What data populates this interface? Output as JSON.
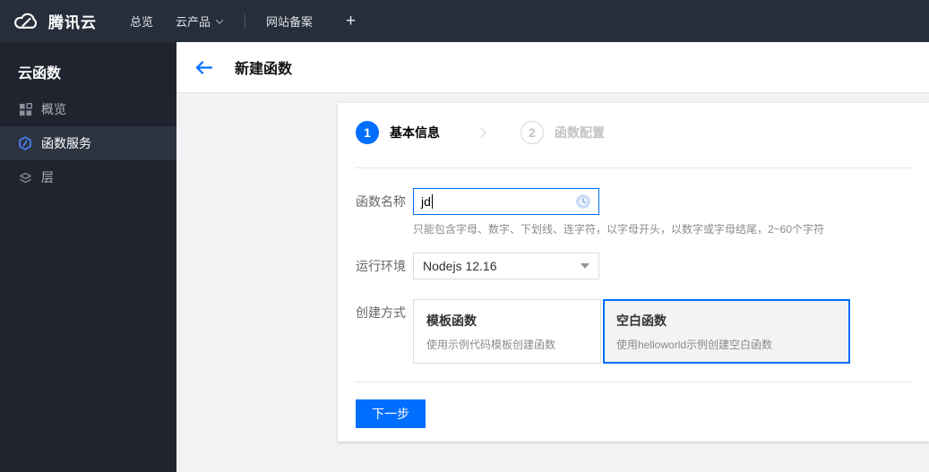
{
  "navbar": {
    "brand": "腾讯云",
    "items": [
      {
        "label": "总览"
      },
      {
        "label": "云产品",
        "has_caret": true
      },
      {
        "label": "网站备案"
      },
      {
        "label": "+"
      }
    ]
  },
  "sidebar": {
    "title": "云函数",
    "items": [
      {
        "label": "概览",
        "icon": "grid-icon",
        "active": false
      },
      {
        "label": "函数服务",
        "icon": "function-service-icon",
        "active": true
      },
      {
        "label": "层",
        "icon": "layers-icon",
        "active": false
      }
    ]
  },
  "header": {
    "title": "新建函数",
    "back_icon": "arrow-left-icon"
  },
  "wizard": {
    "steps": [
      {
        "number": "1",
        "label": "基本信息",
        "state": "active"
      },
      {
        "number": "2",
        "label": "函数配置",
        "state": "upcoming"
      }
    ]
  },
  "form": {
    "name_field": {
      "label": "函数名称",
      "value": "jd",
      "status_icon": "clock-pending-icon",
      "help": "只能包含字母、数字、下划线、连字符，以字母开头，以数字或字母结尾，2~60个字符"
    },
    "runtime_field": {
      "label": "运行环境",
      "value": "Nodejs 12.16"
    },
    "method_field": {
      "label": "创建方式",
      "options": [
        {
          "title": "模板函数",
          "desc": "使用示例代码模板创建函数",
          "selected": false
        },
        {
          "title": "空白函数",
          "desc": "使用helloworld示例创建空白函数",
          "selected": true
        }
      ]
    }
  },
  "actions": {
    "next_label": "下一步"
  },
  "colors": {
    "accent_blue": "#006eff",
    "navbar_bg": "#272e3b",
    "sidebar_bg": "#1f242e",
    "sidebar_active_bg": "#2c3442",
    "content_bg": "#f1f2f4",
    "selected_card_bg": "#f2f3f5",
    "pending_icon_blue": "#b7cff1"
  }
}
